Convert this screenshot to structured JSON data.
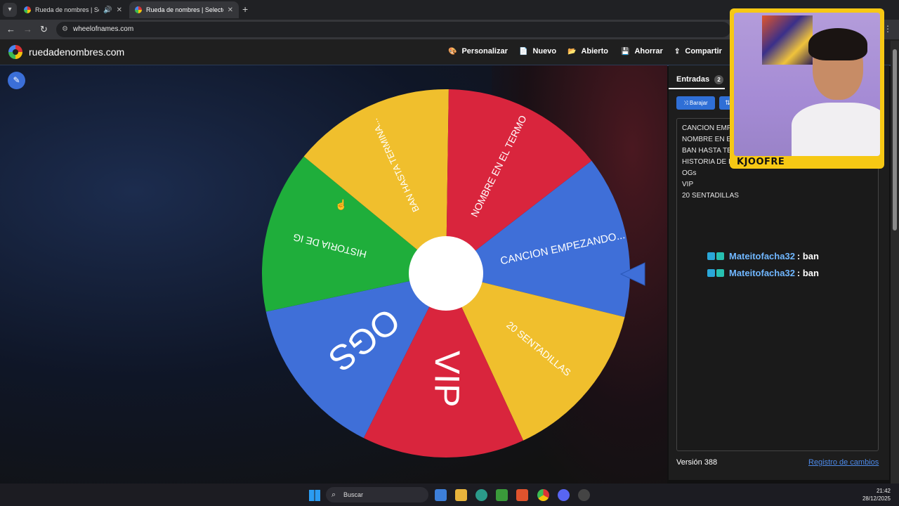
{
  "browser": {
    "tabs": [
      {
        "title": "Rueda de nombres | Selector de..."
      },
      {
        "title": "Rueda de nombres | Selector de..."
      }
    ],
    "url": "wheelofnames.com"
  },
  "site": {
    "brand": "ruedadenombres.com",
    "menu": [
      "Personalizar",
      "Nuevo",
      "Abierto",
      "Ahorrar",
      "Compartir"
    ]
  },
  "wheel": {
    "segments": [
      {
        "label": "CANCION EMPEZANDO...",
        "color": "#3f6fd8"
      },
      {
        "label": "20 SENTADILLAS",
        "color": "#f0bf2d"
      },
      {
        "label": "VIP",
        "color": "#d9253d"
      },
      {
        "label": "OGS",
        "color": "#3f6fd8"
      },
      {
        "label": "HISTORIA DE IG",
        "color": "#1fae3b"
      },
      {
        "label": "BAN HASTA TERMINA...",
        "color": "#f0bf2d"
      },
      {
        "label": "NOMBRE EN EL TERMO",
        "color": "#d9253d"
      }
    ]
  },
  "panel": {
    "tab_label": "Entradas",
    "entry_count": "2",
    "shuffle_label": "Barajar",
    "entries": [
      "CANCION EMP",
      "NOMBRE EN E",
      "BAN HASTA TE",
      "HISTORIA DE I",
      "OGs",
      "VIP",
      "20 SENTADILLAS"
    ],
    "version": "Versión 388",
    "changelog": "Registro de cambios"
  },
  "chat": [
    {
      "user": "Mateitofacha32",
      "message": ": ban"
    },
    {
      "user": "Mateitofacha32",
      "message": ": ban"
    }
  ],
  "webcam": {
    "label": "KJOOFRE"
  },
  "taskbar": {
    "search": "Buscar",
    "time": "21:42",
    "date": "28/12/2025"
  }
}
